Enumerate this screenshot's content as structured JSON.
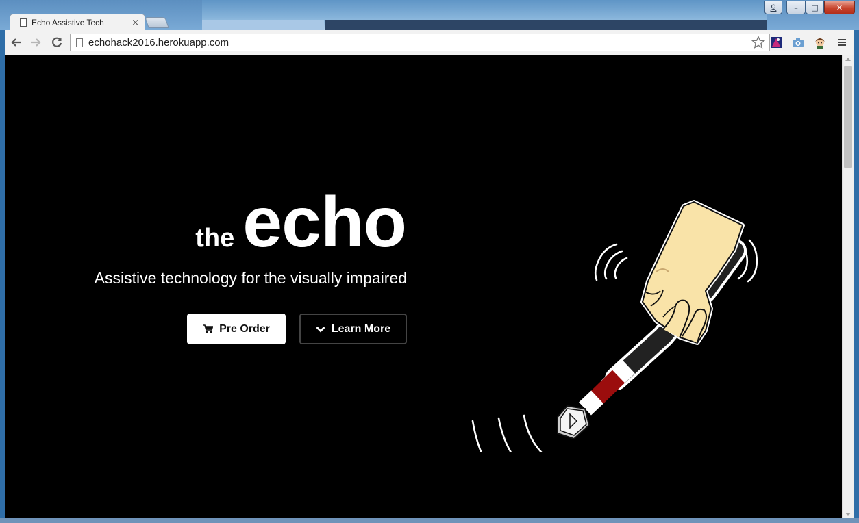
{
  "browser": {
    "tab_title": "Echo Assistive Tech",
    "tab_close": "×",
    "url": "echohack2016.herokuapp.com",
    "icons": [
      "back-arrow-icon",
      "forward-arrow-icon",
      "reload-icon",
      "page-icon",
      "star-icon",
      "extension-icon",
      "camera-icon",
      "avatar-icon",
      "menu-icon"
    ]
  },
  "window_controls": {
    "minimize": "–",
    "maximize": "□",
    "close": "✕"
  },
  "hero": {
    "the": "the",
    "echo": "echo",
    "subtitle": "Assistive technology for the visually impaired",
    "preorder_label": "Pre Order",
    "learnmore_label": "Learn More"
  },
  "colors": {
    "page_background": "#000000",
    "primary_button_bg": "#ffffff",
    "cane_red": "#9b0d0d",
    "hand_skin": "#f9e3a8"
  }
}
